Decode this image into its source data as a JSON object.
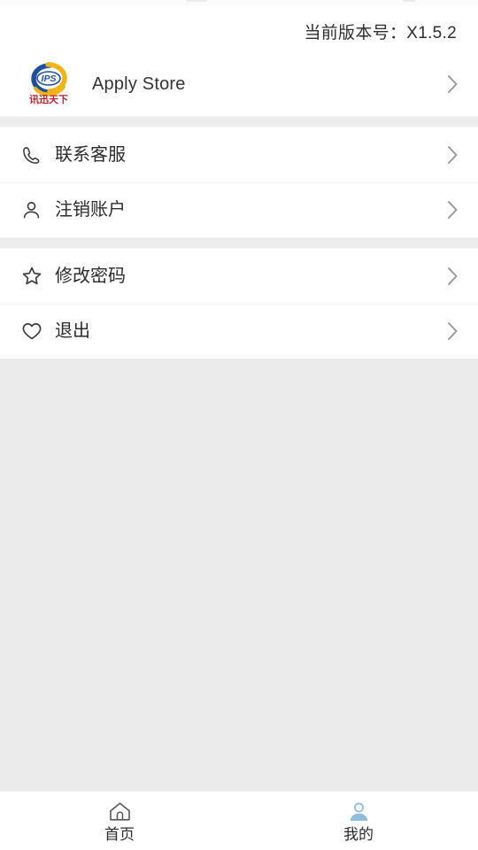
{
  "version": {
    "label": "当前版本号：X1.5.2"
  },
  "brand": {
    "name": "Apply Store",
    "logo_icon": "ips-logo-icon",
    "logo_text_top": "IPS",
    "logo_text_bottom": "讯迅天下",
    "logo_colors": {
      "arc_blue": "#1d4f9e",
      "arc_yellow": "#f0b419",
      "text_red": "#c0202a"
    }
  },
  "groups": [
    {
      "items": [
        {
          "label": "Apply Store",
          "icon": "ips-logo-icon",
          "chevron": "chevron-right-icon",
          "name": "apply-store"
        }
      ]
    },
    {
      "items": [
        {
          "label": "联系客服",
          "icon": "phone-icon",
          "chevron": "chevron-right-icon",
          "name": "contact-support"
        },
        {
          "label": "注销账户",
          "icon": "person-icon",
          "chevron": "chevron-right-icon",
          "name": "delete-account"
        }
      ]
    },
    {
      "items": [
        {
          "label": "修改密码",
          "icon": "star-icon",
          "chevron": "chevron-right-icon",
          "name": "change-password"
        },
        {
          "label": "退出",
          "icon": "heart-icon",
          "chevron": "chevron-right-icon",
          "name": "logout"
        }
      ]
    }
  ],
  "tabbar": {
    "tabs": [
      {
        "label": "首页",
        "icon": "home-icon",
        "active": false
      },
      {
        "label": "我的",
        "icon": "person-icon",
        "active": true
      }
    ],
    "active_color": "#8fbcdd",
    "inactive_color": "#575757"
  }
}
